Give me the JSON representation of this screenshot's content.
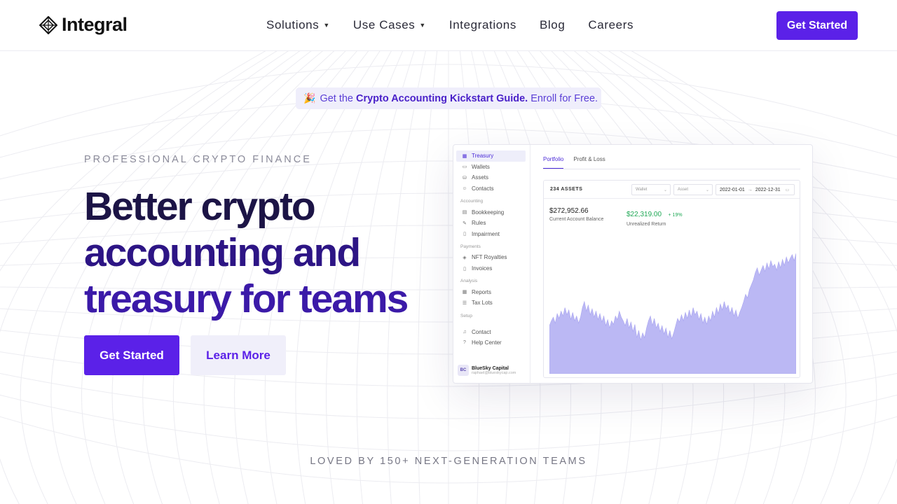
{
  "brand": {
    "name": "Integral"
  },
  "nav": {
    "items": [
      {
        "label": "Solutions",
        "has_dropdown": true
      },
      {
        "label": "Use Cases",
        "has_dropdown": true
      },
      {
        "label": "Integrations",
        "has_dropdown": false
      },
      {
        "label": "Blog",
        "has_dropdown": false
      },
      {
        "label": "Careers",
        "has_dropdown": false
      }
    ],
    "cta_label": "Get Started"
  },
  "announcement": {
    "icon": "party-popper-icon",
    "prefix": "Get the",
    "highlight": "Crypto Accounting Kickstart Guide.",
    "suffix": "Enroll for Free."
  },
  "hero": {
    "eyebrow": "PROFESSIONAL CRYPTO FINANCE",
    "headline_lines": [
      "Better crypto",
      "accounting and",
      "treasury for teams"
    ],
    "primary_button": "Get Started",
    "secondary_button": "Learn More"
  },
  "app_preview": {
    "sidebar": {
      "items_top": [
        {
          "label": "Treasury",
          "icon": "bank-icon",
          "active": true
        },
        {
          "label": "Wallets",
          "icon": "wallet-icon",
          "active": false
        },
        {
          "label": "Assets",
          "icon": "coins-icon",
          "active": false
        },
        {
          "label": "Contacts",
          "icon": "user-icon",
          "active": false
        }
      ],
      "section_accounting": "Accounting",
      "items_accounting": [
        {
          "label": "Bookkeeping",
          "icon": "book-icon"
        },
        {
          "label": "Rules",
          "icon": "wrench-icon"
        },
        {
          "label": "Impairment",
          "icon": "document-icon"
        }
      ],
      "section_payments": "Payments",
      "items_payments": [
        {
          "label": "NFT Royalties",
          "icon": "diamond-icon"
        },
        {
          "label": "Invoices",
          "icon": "invoice-icon"
        }
      ],
      "section_analysis": "Analysis",
      "items_analysis": [
        {
          "label": "Reports",
          "icon": "table-icon"
        },
        {
          "label": "Tax Lots",
          "icon": "stack-icon"
        }
      ],
      "section_setup": "Setup",
      "items_setup": [
        {
          "label": "Contact",
          "icon": "headset-icon"
        },
        {
          "label": "Help Center",
          "icon": "help-icon"
        }
      ],
      "user": {
        "initials": "BC",
        "name": "BlueSky Capital",
        "email": "raphael@blueskycap.com"
      }
    },
    "tabs": [
      "Portfolio",
      "Profit & Loss"
    ],
    "active_tab": "Portfolio",
    "assets_count": "234 ASSETS",
    "filters": {
      "wallet": "Wallet",
      "asset": "Asset"
    },
    "date_from": "2022-01-01",
    "date_to": "2022-12-31",
    "balance": {
      "value": "$272,952.66",
      "label": "Current Account Balance"
    },
    "return": {
      "value": "$22,319.00",
      "pct": "+ 19%",
      "label": "Unrealized Return"
    },
    "colors": {
      "accent": "#5b21e8",
      "chart_fill": "#bbb8f4",
      "positive": "#1fa855"
    }
  },
  "chart_data": {
    "type": "area",
    "title": "",
    "xlabel": "",
    "ylabel": "",
    "x_range": [
      "2022-01-01",
      "2022-12-31"
    ],
    "ylim": [
      0,
      100
    ],
    "values": [
      40,
      44,
      47,
      42,
      50,
      46,
      52,
      48,
      55,
      49,
      53,
      45,
      51,
      44,
      48,
      42,
      47,
      55,
      60,
      52,
      57,
      49,
      54,
      47,
      52,
      45,
      50,
      43,
      48,
      40,
      45,
      38,
      44,
      41,
      48,
      45,
      52,
      47,
      44,
      40,
      46,
      38,
      43,
      35,
      41,
      30,
      36,
      28,
      34,
      30,
      38,
      44,
      48,
      40,
      46,
      38,
      42,
      35,
      40,
      33,
      38,
      30,
      36,
      29,
      34,
      40,
      46,
      43,
      49,
      44,
      51,
      46,
      53,
      47,
      55,
      49,
      52,
      45,
      50,
      42,
      47,
      41,
      48,
      44,
      52,
      47,
      55,
      50,
      58,
      53,
      60,
      54,
      57,
      50,
      55,
      48,
      53,
      46,
      51,
      55,
      60,
      66,
      63,
      70,
      74,
      78,
      84,
      88,
      82,
      86,
      90,
      85,
      92,
      87,
      94,
      89,
      91,
      86,
      93,
      88,
      95,
      90,
      97,
      92,
      96,
      99,
      94,
      100
    ]
  },
  "social_proof": {
    "label": "LOVED BY 150+ NEXT-GENERATION TEAMS"
  }
}
